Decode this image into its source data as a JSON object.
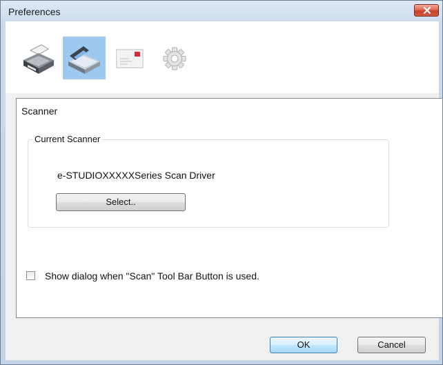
{
  "window": {
    "title": "Preferences"
  },
  "icons": {
    "close": "close-icon",
    "printer": "printer-icon",
    "scanner": "scanner-icon",
    "email": "email-icon",
    "settings": "gear-icon"
  },
  "toolbar": {
    "selected_item": "scanner"
  },
  "panel": {
    "title": "Scanner",
    "group": {
      "legend": "Current Scanner",
      "scanner_name": "e-STUDIOXXXXXSeries Scan Driver",
      "select_label": "Select.."
    },
    "checkbox": {
      "label": "Show dialog when \"Scan\" Tool Bar Button is used.",
      "checked": false
    }
  },
  "buttons": {
    "ok": "OK",
    "cancel": "Cancel"
  },
  "colors": {
    "selected_tool_bg": "#9ec9ef",
    "ok_button_border": "#3c7fb1",
    "close_button": "#c7402b"
  }
}
